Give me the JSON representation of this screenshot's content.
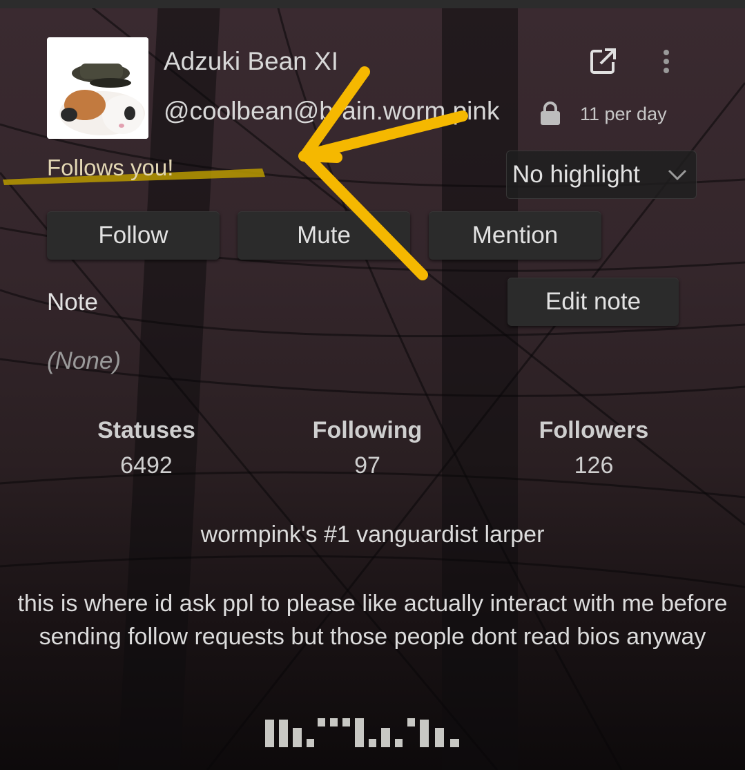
{
  "profile": {
    "display_name": "Adzuki Bean XI",
    "handle": "@coolbean@brain.worm.pink",
    "posts_per_day": "11 per day",
    "follows_you": "Follows you!"
  },
  "highlight_select": {
    "selected": "No highlight"
  },
  "actions": {
    "follow": "Follow",
    "mute": "Mute",
    "mention": "Mention",
    "edit_note": "Edit note"
  },
  "note": {
    "label": "Note",
    "value": "(None)"
  },
  "stats": [
    {
      "label": "Statuses",
      "value": "6492"
    },
    {
      "label": "Following",
      "value": "97"
    },
    {
      "label": "Followers",
      "value": "126"
    }
  ],
  "bio": {
    "title": "wormpink's #1 vanguardist larper",
    "body": "this is where id ask ppl to please like actually interact with me before sending follow requests but those people dont read bios anyway"
  },
  "colors": {
    "annotation_arrow": "#f5b800",
    "highlight_marker": "#b99a00"
  },
  "icons": {
    "external_link": "external-link-icon",
    "menu": "kebab-menu-icon",
    "lock": "lock-icon",
    "chevron": "chevron-down-icon"
  }
}
